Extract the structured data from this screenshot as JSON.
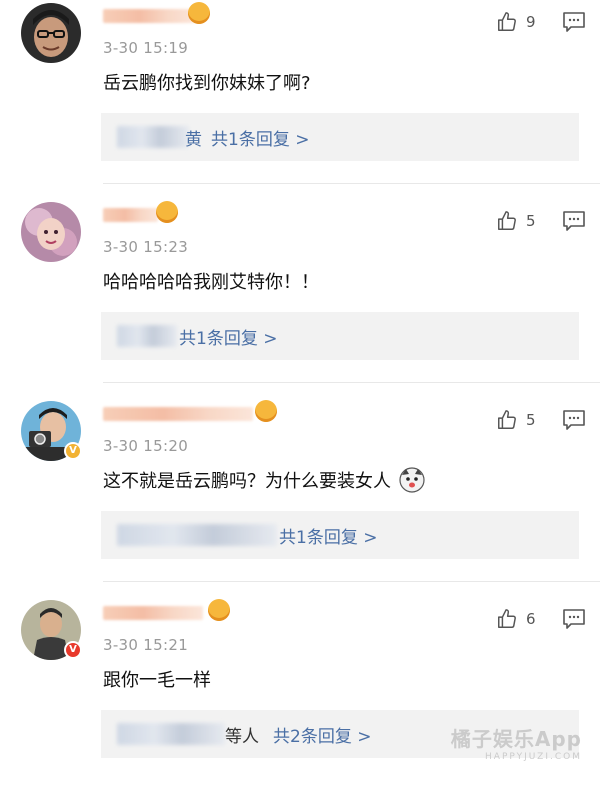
{
  "comments": [
    {
      "time": "3-30 15:19",
      "text": "岳云鹏你找到你妹妹了啊?",
      "likes": "9",
      "reply_prefix": "黄",
      "reply_summary": "共1条回复 >"
    },
    {
      "time": "3-30 15:23",
      "text": "哈哈哈哈哈我刚艾特你！！",
      "likes": "5",
      "reply_prefix": "",
      "reply_summary": "共1条回复 >"
    },
    {
      "time": "3-30 15:20",
      "text": "这不就是岳云鹏吗？为什么要装女人",
      "likes": "5",
      "reply_prefix": "",
      "reply_summary": "共1条回复 >"
    },
    {
      "time": "3-30 15:21",
      "text": "跟你一毛一样",
      "likes": "6",
      "reply_prefix": "等人",
      "reply_summary": "共2条回复 >"
    }
  ],
  "watermark": {
    "main": "橘子娱乐App",
    "sub": "HAPPYJUZI.COM"
  },
  "icons": {
    "like": "thumbs-up-icon",
    "reply": "comment-bubble-icon"
  },
  "colors": {
    "link": "#4a6fa5",
    "time": "#999999",
    "reply_bg": "#f2f2f2"
  }
}
